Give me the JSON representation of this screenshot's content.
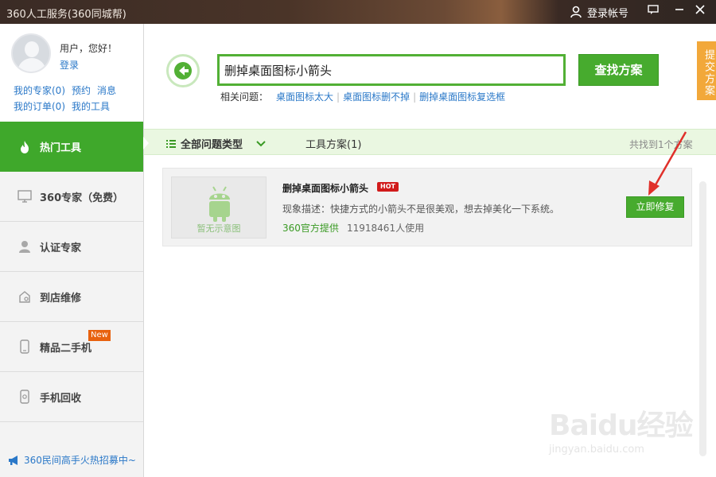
{
  "titlebar": {
    "title": "360人工服务(360同城帮)",
    "login_label": "登录帐号",
    "icons": [
      "user-icon",
      "message-icon",
      "minimize-icon",
      "close-icon"
    ]
  },
  "sidebar": {
    "greeting": "用户，您好！",
    "login_link": "登录",
    "user_links_row1": [
      "我的专家(0)",
      "预约",
      "消息"
    ],
    "user_links_row2": [
      "我的订单(0)",
      "我的工具"
    ],
    "items": [
      {
        "label": "热门工具",
        "icon": "flame-icon",
        "active": true
      },
      {
        "label": "360专家（免费）",
        "icon": "monitor-icon"
      },
      {
        "label": "认证专家",
        "icon": "person-icon"
      },
      {
        "label": "到店维修",
        "icon": "store-icon"
      },
      {
        "label": "精品二手机",
        "icon": "phone-icon",
        "badge": "New"
      },
      {
        "label": "手机回收",
        "icon": "recycle-phone-icon"
      }
    ],
    "bottom_link": "360民间高手火热招募中~"
  },
  "search": {
    "value": "删掉桌面图标小箭头",
    "button": "查找方案",
    "related_label": "相关问题：",
    "related": [
      "桌面图标太大",
      "桌面图标删不掉",
      "删掉桌面图标复选框"
    ]
  },
  "side_tab": "提交方案",
  "filter": {
    "all_label": "全部问题类型",
    "tools_label": "工具方案(1)",
    "count": "共找到1个方案"
  },
  "result": {
    "no_image": "暂无示意图",
    "title": "删掉桌面图标小箭头",
    "hot_badge": "HOT",
    "description": "现象描述：快捷方式的小箭头不是很美观，想去掉美化一下系统。",
    "provider": "360官方提供",
    "users": "11918461人使用",
    "fix_button": "立即修复"
  },
  "watermark": {
    "text": "Baidu经验",
    "url": "jingyan.baidu.com"
  },
  "colors": {
    "accent_green": "#47ab2e",
    "link_blue": "#2a78c8",
    "hot_red": "#d11b1b",
    "side_tab_orange": "#f2a83a",
    "annotation_arrow": "#e0302a"
  }
}
